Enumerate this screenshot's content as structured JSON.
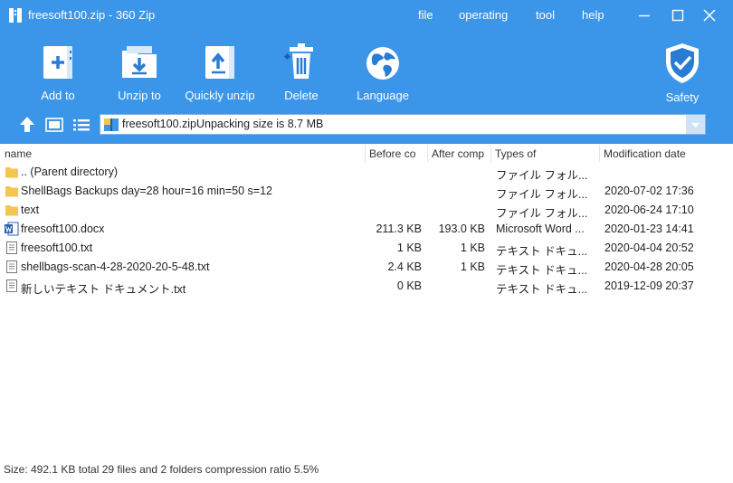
{
  "window": {
    "title": "freesoft100.zip - 360 Zip",
    "menu": [
      "file",
      "operating",
      "tool",
      "help"
    ]
  },
  "toolbar": {
    "add_label": "Add to",
    "unzip_label": "Unzip to",
    "quick_unzip_label": "Quickly unzip",
    "delete_label": "Delete",
    "language_label": "Language",
    "safety_label": "Safety"
  },
  "path": {
    "value": "freesoft100.zipUnpacking size is 8.7 MB"
  },
  "table": {
    "headers": {
      "name": "name",
      "before": "Before co",
      "after": "After comp",
      "type": "Types of",
      "modified": "Modification date"
    },
    "rows": [
      {
        "icon": "folder",
        "name": ".. (Parent directory)",
        "before": "",
        "after": "",
        "type": "ファイル フォル...",
        "modified": ""
      },
      {
        "icon": "folder",
        "name": "ShellBags Backups day=28 hour=16 min=50 s=12",
        "before": "",
        "after": "",
        "type": "ファイル フォル...",
        "modified": "2020-07-02 17:36"
      },
      {
        "icon": "folder",
        "name": "text",
        "before": "",
        "after": "",
        "type": "ファイル フォル...",
        "modified": "2020-06-24 17:10"
      },
      {
        "icon": "word",
        "name": "freesoft100.docx",
        "before": "211.3 KB",
        "after": "193.0 KB",
        "type": "Microsoft Word ...",
        "modified": "2020-01-23 14:41"
      },
      {
        "icon": "text",
        "name": "freesoft100.txt",
        "before": "1 KB",
        "after": "1 KB",
        "type": "テキスト ドキュ...",
        "modified": "2020-04-04 20:52"
      },
      {
        "icon": "text",
        "name": "shellbags-scan-4-28-2020-20-5-48.txt",
        "before": "2.4 KB",
        "after": "1 KB",
        "type": "テキスト ドキュ...",
        "modified": "2020-04-28 20:05"
      },
      {
        "icon": "text",
        "name": "新しいテキスト ドキュメント.txt",
        "before": "0 KB",
        "after": "",
        "type": "テキスト ドキュ...",
        "modified": "2019-12-09 20:37"
      }
    ]
  },
  "status": {
    "text": "Size: 492.1 KB total 29 files and 2 folders compression ratio 5.5%"
  },
  "colors": {
    "accent": "#3b95e8",
    "folder": "#f5c64f",
    "word": "#2b5fb3"
  }
}
